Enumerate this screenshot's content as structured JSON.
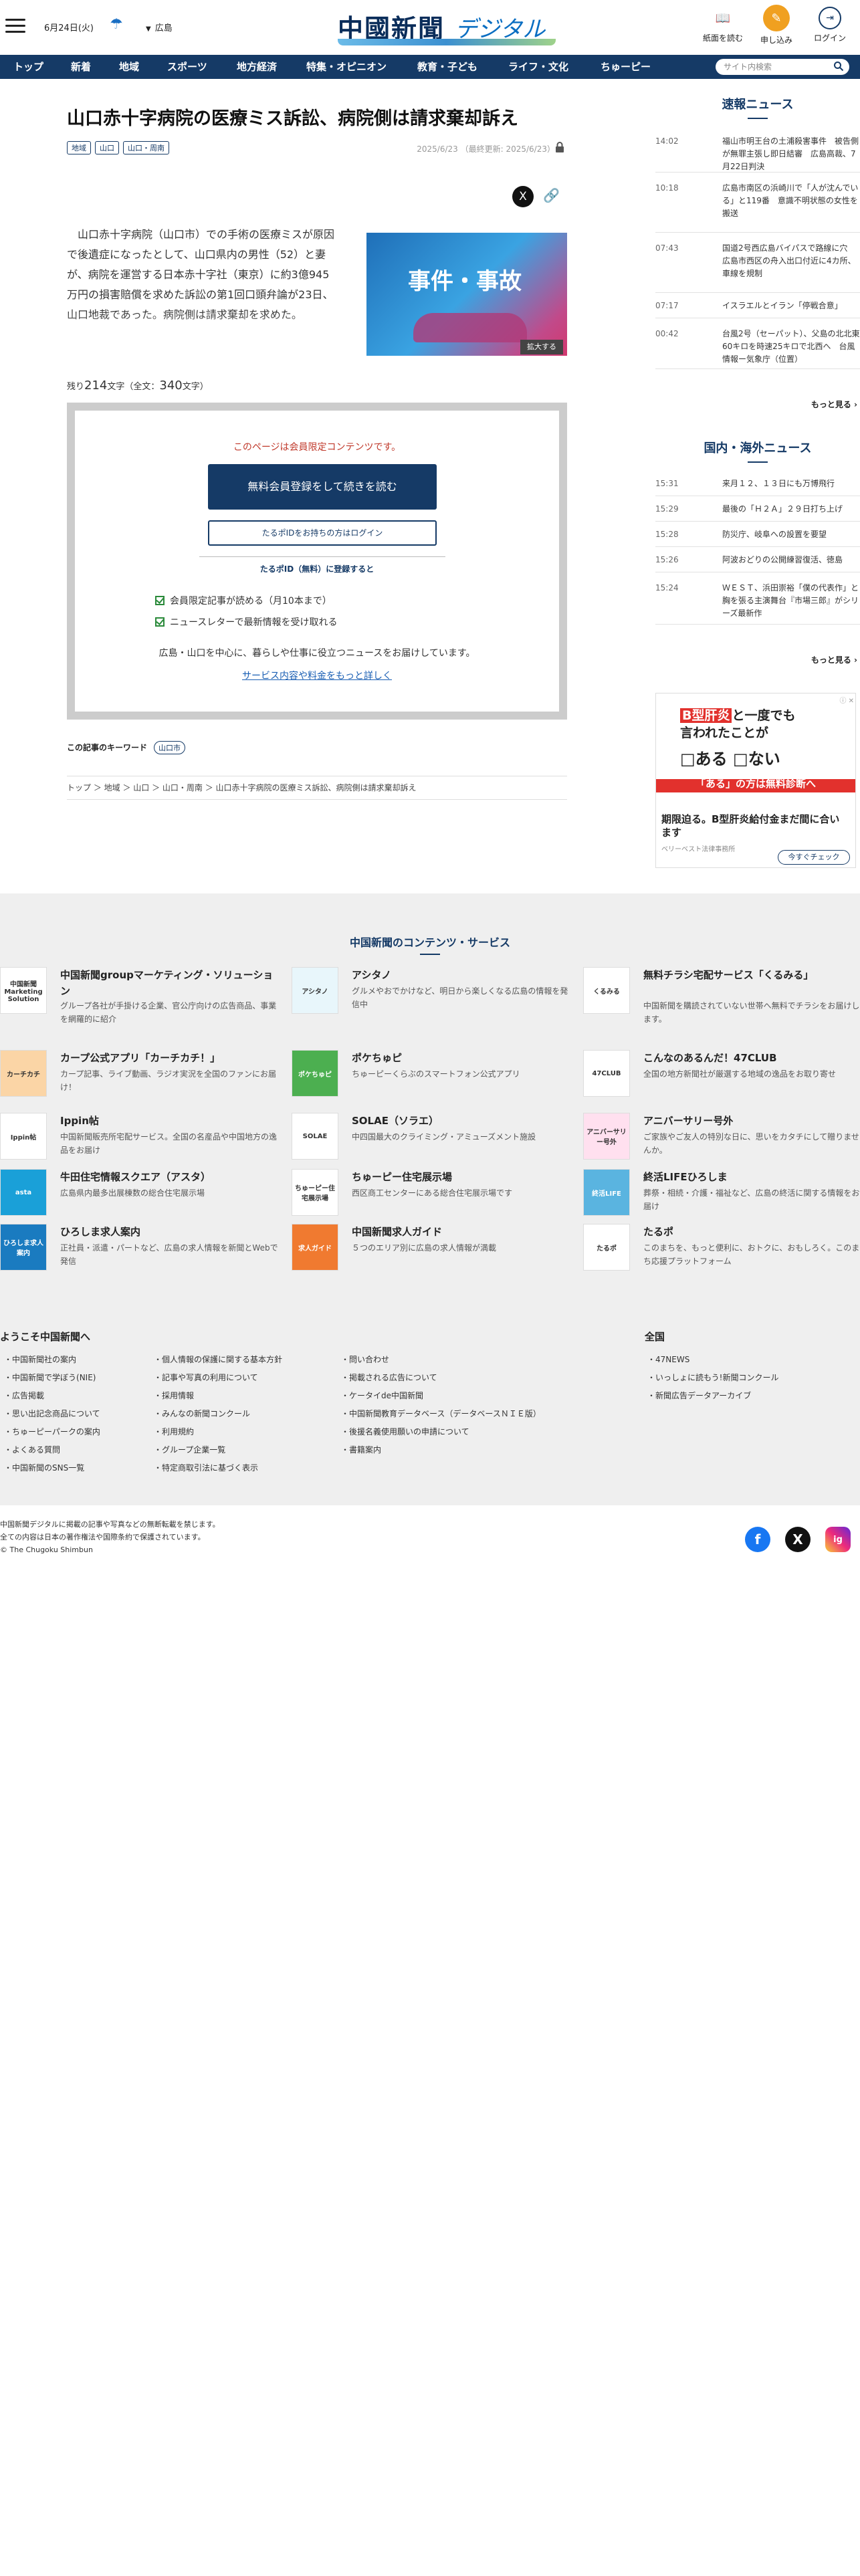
{
  "header": {
    "date": "6月24日(火)",
    "region": "広島",
    "logo_main": "中國新聞",
    "logo_sub": "デジタル",
    "btn_read": "紙面を読む",
    "btn_apply": "申し込み",
    "btn_login": "ログイン"
  },
  "nav": {
    "items": [
      "トップ",
      "新着",
      "地域",
      "スポーツ",
      "地方経済",
      "特集・オピニオン",
      "教育・子ども",
      "ライフ・文化",
      "ちゅーピー"
    ],
    "search_placeholder": "サイト内検索"
  },
  "article": {
    "title": "山口赤十字病院の医療ミス訴訟、病院側は請求棄却訴え",
    "tags": [
      "地域",
      "山口",
      "山口・周南"
    ],
    "dates": "2025/6/23 （最終更新: 2025/6/23）",
    "lead": "山口赤十字病院（山口市）での手術の医療ミスが原因で後遺症になったとして、山口県内の男性（52）と妻が、病院を運営する日本赤十字社（東京）に約3億945万円の損害賠償を求めた訴訟の第1回口頭弁論が23日、山口地裁であった。病院側は請求棄却を求めた。",
    "photo_text": "事件・事故",
    "zoom": "拡大する",
    "remaining_label": "残り",
    "remaining": "214",
    "remaining_unit": "文字（全文：",
    "total": "340",
    "total_unit": "文字）"
  },
  "paywall": {
    "message": "このページは会員限定コンテンツです。",
    "register_btn": "無料会員登録をして続きを読む",
    "login_btn": "たるポIDをお持ちの方はログイン",
    "sub": "たるポID（無料）に登録すると",
    "benefits": [
      "会員限定記事が読める（月10本まで）",
      "ニュースレターで最新情報を受け取れる"
    ],
    "local": "広島・山口を中心に、暮らしや仕事に役立つニュースをお届けしています。",
    "more": "サービス内容や料金をもっと詳しく"
  },
  "keywords": {
    "label": "この記事のキーワード",
    "items": [
      "山口市"
    ]
  },
  "breadcrumb": "トップ ＞ 地域 ＞ 山口 ＞ 山口・周南 ＞ 山口赤十字病院の医療ミス訴訟、病院側は請求棄却訴え",
  "sidebar": {
    "breaking_title": "速報ニュース",
    "breaking": [
      {
        "time": "14:02",
        "text": "福山市明王台の土浦殺害事件　被告側が無罪主張し即日結審　広島高裁、7月22日判決"
      },
      {
        "time": "10:18",
        "text": "広島市南区の浜崎川で「人が沈んでいる」と119番　意識不明状態の女性を搬送"
      },
      {
        "time": "07:43",
        "text": "国道2号西広島バイパスで路線に穴　広島市西区の舟入出口付近に4カ所、車線を規制"
      },
      {
        "time": "07:17",
        "text": "イスラエルとイラン「停戦合意」"
      },
      {
        "time": "00:42",
        "text": "台風2号（セーパット）、父島の北北東60キロを時速25キロで北西へ　台風情報ー気象庁（位置）"
      }
    ],
    "more": "もっと見る",
    "world_title": "国内・海外ニュース",
    "world": [
      {
        "time": "15:31",
        "text": "来月１２、１３日にも万博飛行"
      },
      {
        "time": "15:29",
        "text": "最後の「Ｈ２Ａ」２９日打ち上げ"
      },
      {
        "time": "15:28",
        "text": "防災庁、岐阜への設置を要望"
      },
      {
        "time": "15:26",
        "text": "阿波おどりの公開練習復活、徳島"
      },
      {
        "time": "15:24",
        "text": "ＷＥＳＴ、浜田崇裕「僕の代表作」と胸を張る主演舞台『市場三郎』がシリーズ最新作"
      }
    ]
  },
  "ad": {
    "line1a": "B型肝炎",
    "line1b": "と一度でも",
    "line2": "言われたことが",
    "line3": "□ある □ない",
    "banner": "「ある」の方は無料診断へ",
    "headline": "期限迫る。B型肝炎給付金まだ間に合います",
    "sponsor": "ベリーベスト法律事務所",
    "cta": "今すぐチェック",
    "close": "ⓘ ✕"
  },
  "services": {
    "title": "中国新聞のコンテンツ・サービス",
    "items": [
      {
        "name": "中国新聞groupマーケティング・ソリューション",
        "desc": "グループ各社が手掛ける企業、官公庁向けの広告商品、事業を網羅的に紹介",
        "icon": "中国新聞Marketing Solution"
      },
      {
        "name": "アシタノ",
        "desc": "グルメやおでかけなど、明日から楽しくなる広島の情報を発信中",
        "icon": "アシタノ"
      },
      {
        "name": "無料チラシ宅配サービス「くるみる」",
        "desc": "中国新聞を購読されていない世帯へ無料でチラシをお届けします。",
        "icon": "くるみる"
      },
      {
        "name": "カープ公式アプリ「カーチカチ！」",
        "desc": "カープ記事、ライブ動画、ラジオ実況を全国のファンにお届け！",
        "icon": "カーチカチ"
      },
      {
        "name": "ポケちゅピ",
        "desc": "ちゅーピーくらぶのスマートフォン公式アプリ",
        "icon": "ポケちゅピ"
      },
      {
        "name": "こんなのあるんだ！47CLUB",
        "desc": "全国の地方新聞社が厳選する地域の逸品をお取り寄せ",
        "icon": "47CLUB"
      },
      {
        "name": "Ippin帖",
        "desc": "中国新聞販売所宅配サービス。全国の名産品や中国地方の逸品をお届け",
        "icon": "Ippin帖"
      },
      {
        "name": "SOLAE（ソラエ）",
        "desc": "中四国最大のクライミング・アミューズメント施設",
        "icon": "SOLAE"
      },
      {
        "name": "アニバーサリー号外",
        "desc": "ご家族やご友人の特別な日に、思いをカタチにして贈りませんか。",
        "icon": "アニバーサリー号外"
      },
      {
        "name": "牛田住宅情報スクエア（アスタ）",
        "desc": "広島県内最多出展棟数の総合住宅展示場",
        "icon": "asta"
      },
      {
        "name": "ちゅーピー住宅展示場",
        "desc": "西区商工センターにある総合住宅展示場です",
        "icon": "ちゅーピー住宅展示場"
      },
      {
        "name": "終活LIFEひろしま",
        "desc": "葬祭・相続・介護・福祉など、広島の終活に関する情報をお届け",
        "icon": "終活LIFE"
      },
      {
        "name": "ひろしま求人案内",
        "desc": "正社員・派遣・パートなど、広島の求人情報を新聞とWebで発信",
        "icon": "ひろしま求人案内"
      },
      {
        "name": "中国新聞求人ガイド",
        "desc": "５つのエリア別に広島の求人情報が満載",
        "icon": "求人ガイド"
      },
      {
        "name": "たるポ",
        "desc": "このまちを、もっと便利に、おトクに、おもしろく。このまち応援プラットフォーム",
        "icon": "たるポ"
      }
    ]
  },
  "footer": {
    "welcome_title": "ようこそ中国新聞へ",
    "col1": [
      "中国新聞社の案内",
      "中国新聞で学ぼう(NIE)",
      "広告掲載",
      "思い出記念商品について",
      "ちゅーピーパークの案内",
      "よくある質問",
      "中国新聞のSNS一覧"
    ],
    "col2": [
      "個人情報の保護に関する基本方針",
      "記事や写真の利用について",
      "採用情報",
      "みんなの新聞コンクール",
      "利用規約",
      "グループ企業一覧",
      "特定商取引法に基づく表示"
    ],
    "col3": [
      "問い合わせ",
      "掲載される広告について",
      "ケータイde中国新聞",
      "中国新聞教育データベース（データベースＮＩＥ版）",
      "後援名義使用願いの申請について",
      "書籍案内"
    ],
    "national_title": "全国",
    "national": [
      "47NEWS",
      "いっしょに読もう!新聞コンクール",
      "新聞広告データアーカイブ"
    ],
    "copyright": [
      "中国新聞デジタルに掲載の記事や写真などの無断転載を禁じます。",
      "全ての内容は日本の著作権法や国際条約で保護されています。",
      "© The Chugoku Shimbun"
    ],
    "social": [
      "f",
      "X",
      "ig"
    ]
  }
}
